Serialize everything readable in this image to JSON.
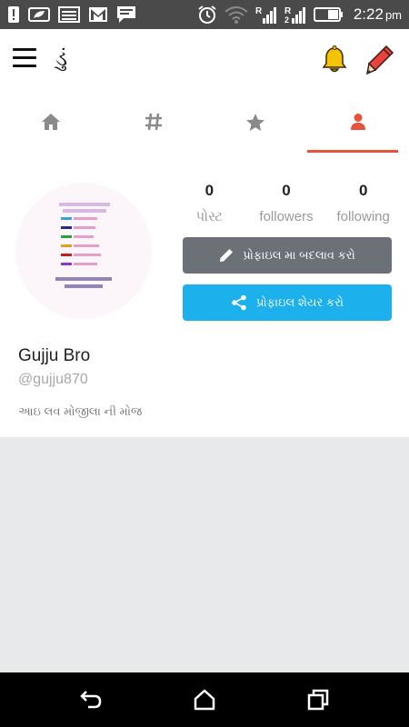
{
  "status_bar": {
    "time": "2:22",
    "ampm": "pm",
    "left_icons": [
      "warning-icon",
      "leaf-icon",
      "image-icon",
      "gmail-icon",
      "message-icon"
    ],
    "right_icons": [
      "alarm-icon",
      "wifi-icon",
      "signal-r-icon",
      "signal-2-icon",
      "battery-icon"
    ]
  },
  "app_bar": {
    "logo": "ડું"
  },
  "tabs": [
    {
      "icon": "home-icon",
      "active": false
    },
    {
      "icon": "hashtag-icon",
      "active": false
    },
    {
      "icon": "star-icon",
      "active": false
    },
    {
      "icon": "person-icon",
      "active": true
    }
  ],
  "profile": {
    "stats": [
      {
        "count": "0",
        "label": "પોસ્ટ"
      },
      {
        "count": "0",
        "label": "followers"
      },
      {
        "count": "0",
        "label": "following"
      }
    ],
    "edit_button": "પ્રોફાઇલ મા બદલાવ કરો",
    "share_button": "પ્રોફાઇલ શેયર કરો",
    "name": "Gujju Bro",
    "handle": "@gujju870",
    "bio": "આઇ લવ મોજીલા ની મોજ"
  },
  "nav_bar": {
    "buttons": [
      "back-icon",
      "home-icon",
      "recents-icon"
    ]
  },
  "colors": {
    "accent": "#e6533a",
    "edit_button": "#6c7178",
    "share_button": "#1cb0ec",
    "bell": "#f5c400",
    "pencil": "#e8423a"
  }
}
